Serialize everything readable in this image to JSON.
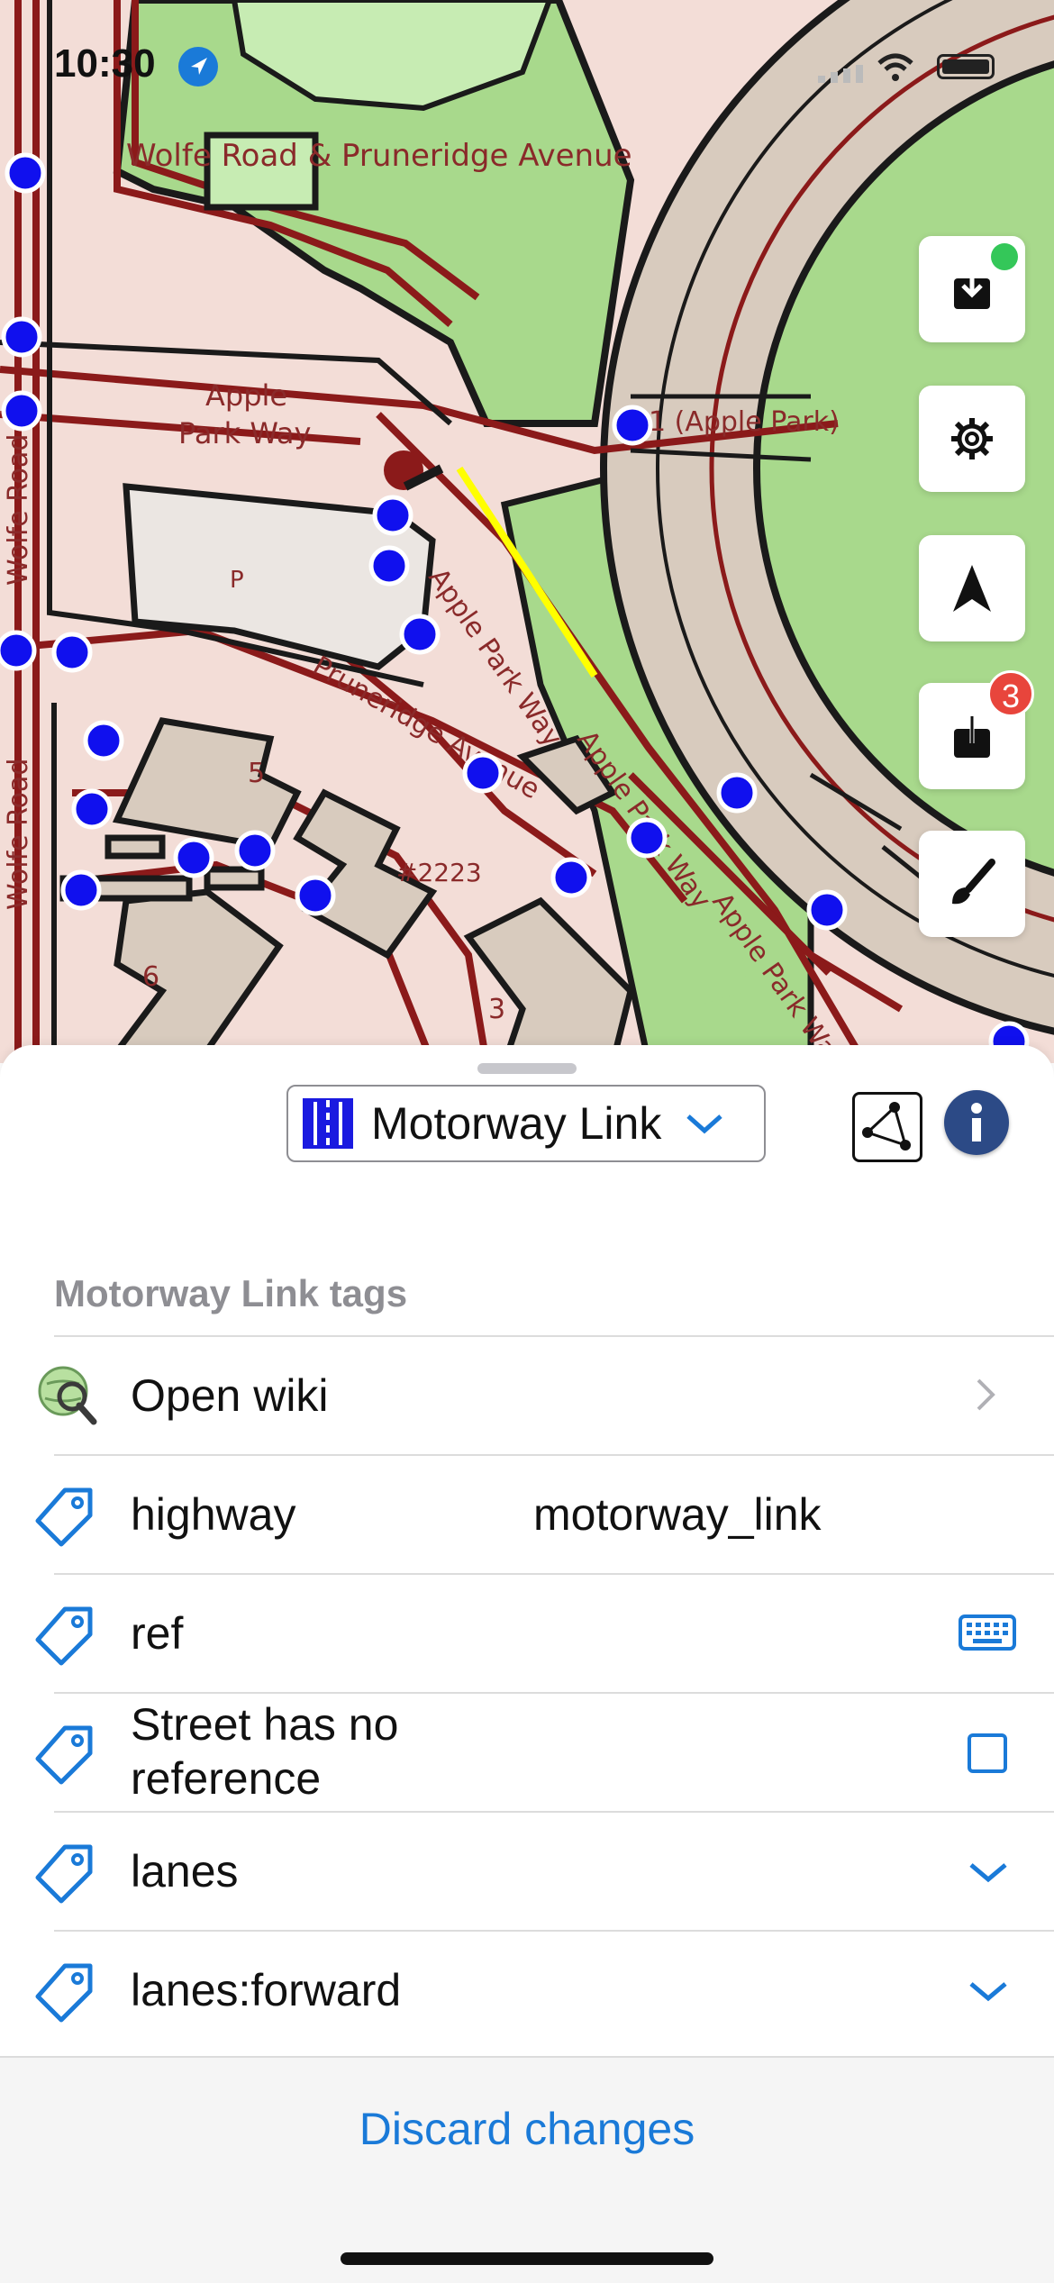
{
  "status_bar": {
    "time": "10:30"
  },
  "map": {
    "labels": {
      "wolfe_pruneridge": "Wolfe Road & Pruneridge Avenue",
      "apple_park_way_1": "Apple",
      "apple_park_way_2": "Park Way",
      "apple_park_way_diag": "Apple Park Way",
      "pruneridge_avenue": "Pruneridge Avenue",
      "wolfe_road_1": "Wolfe Road",
      "wolfe_road_2": "Wolfe Road",
      "apple_park_bldg": "1 (Apple Park)",
      "bldg_5": "5",
      "bldg_6": "6",
      "bldg_3": "3",
      "house_number": "#2223",
      "apple_park_way_right": "Apple Park Way",
      "apple_park_way_mid": "Apple Park Way",
      "parking": "P"
    }
  },
  "side_buttons": {
    "download_badge_color": "#34c759",
    "upload_badge": "3"
  },
  "sheet": {
    "feature_type": "Motorway Link",
    "section_header": "Motorway Link tags",
    "rows": [
      {
        "key": "Open wiki",
        "value": ""
      },
      {
        "key": "highway",
        "value": "motorway_link"
      },
      {
        "key": "ref",
        "value": ""
      },
      {
        "key": "Street has no reference",
        "value": ""
      },
      {
        "key": "lanes",
        "value": ""
      },
      {
        "key": "lanes:forward",
        "value": ""
      }
    ],
    "discard_label": "Discard changes"
  },
  "colors": {
    "accent": "#1a7ad8",
    "map_road": "#8b1a1a",
    "map_green": "#a3d98a",
    "map_residential": "#f6dcd6"
  }
}
